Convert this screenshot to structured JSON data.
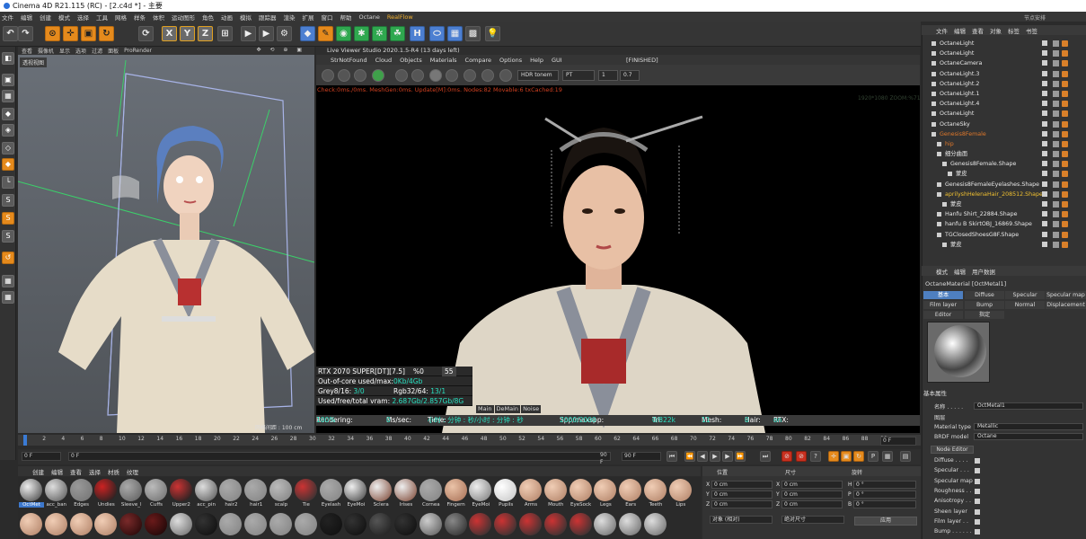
{
  "app": {
    "title": "Cinema 4D R21.115 (RC) - [2.c4d *] - 主要",
    "right_label": "节点安排"
  },
  "menubar": [
    "文件",
    "编辑",
    "创建",
    "模式",
    "选择",
    "工具",
    "网格",
    "样条",
    "体积",
    "运动图形",
    "角色",
    "动画",
    "模拟",
    "跟踪器",
    "渲染",
    "扩展",
    "窗口",
    "帮助",
    "Octane"
  ],
  "menubar_rf": "RealFlow",
  "toolbar": {
    "buttons": [
      {
        "name": "undo-button",
        "glyph": "↶",
        "style": ""
      },
      {
        "name": "redo-button",
        "glyph": "↷",
        "style": ""
      },
      {
        "name": "live-select-button",
        "glyph": "⊙",
        "style": "orange"
      },
      {
        "name": "move-button",
        "glyph": "✛",
        "style": "orange"
      },
      {
        "name": "scale-button",
        "glyph": "▣",
        "style": "orange"
      },
      {
        "name": "rotate-button",
        "glyph": "↻",
        "style": "orange"
      },
      {
        "name": "recent-tool-button",
        "glyph": "⟳",
        "style": ""
      },
      {
        "name": "axis-x-button",
        "glyph": "X",
        "style": "sel"
      },
      {
        "name": "axis-y-button",
        "glyph": "Y",
        "style": "sel"
      },
      {
        "name": "axis-z-button",
        "glyph": "Z",
        "style": "sel"
      },
      {
        "name": "coord-system-button",
        "glyph": "⊞",
        "style": ""
      },
      {
        "name": "render-view-button",
        "glyph": "▶",
        "style": ""
      },
      {
        "name": "render-pv-button",
        "glyph": "▶",
        "style": ""
      },
      {
        "name": "render-settings-button",
        "glyph": "⚙",
        "style": ""
      },
      {
        "name": "cube-button",
        "glyph": "◆",
        "style": "blue"
      },
      {
        "name": "pen-button",
        "glyph": "✎",
        "style": "orange"
      },
      {
        "name": "subdivision-button",
        "glyph": "◉",
        "style": "green"
      },
      {
        "name": "cloner-button",
        "glyph": "✱",
        "style": "green"
      },
      {
        "name": "deformer-button",
        "glyph": "✲",
        "style": "green"
      },
      {
        "name": "environment-button",
        "glyph": "☘",
        "style": "green"
      },
      {
        "name": "field-button",
        "glyph": "H",
        "style": "blue"
      },
      {
        "name": "tag-button",
        "glyph": "⬭",
        "style": "blue"
      },
      {
        "name": "floor-button",
        "glyph": "▦",
        "style": "blue"
      },
      {
        "name": "camera-button",
        "glyph": "▩",
        "style": ""
      },
      {
        "name": "light-button",
        "glyph": "💡",
        "style": ""
      }
    ]
  },
  "left_tools": [
    {
      "name": "make-editable-icon",
      "glyph": "◧",
      "style": ""
    },
    {
      "name": "model-mode-icon",
      "glyph": "▣",
      "style": ""
    },
    {
      "name": "texture-mode-icon",
      "glyph": "▦",
      "style": ""
    },
    {
      "name": "object-mode-icon",
      "glyph": "◆",
      "style": ""
    },
    {
      "name": "points-mode-icon",
      "glyph": "◈",
      "style": ""
    },
    {
      "name": "edges-mode-icon",
      "glyph": "◇",
      "style": ""
    },
    {
      "name": "polygons-mode-icon",
      "glyph": "◆",
      "style": "orange"
    },
    {
      "name": "axis-mode-icon",
      "glyph": "└",
      "style": ""
    },
    {
      "name": "snap-icon",
      "glyph": "S",
      "style": ""
    },
    {
      "name": "snap-settings-icon",
      "glyph": "S",
      "style": "orange"
    },
    {
      "name": "snap-quantize-icon",
      "glyph": "S",
      "style": ""
    },
    {
      "name": "workplane-icon",
      "glyph": "↺",
      "style": "orange"
    },
    {
      "name": "grid-icon",
      "glyph": "▦",
      "style": ""
    },
    {
      "name": "locked-workplane-icon",
      "glyph": "▦",
      "style": ""
    }
  ],
  "viewport": {
    "menu": [
      "查看",
      "摄像机",
      "显示",
      "选项",
      "过滤",
      "面板",
      "ProRender"
    ],
    "label": "透视视图",
    "grid": "网格间距 : 100 cm"
  },
  "liveviewer": {
    "title": "Live Viewer Studio 2020.1.5-R4 (13 days left)",
    "menu": [
      "StrNotFound",
      "Cloud",
      "Objects",
      "Materials",
      "Compare",
      "Options",
      "Help",
      "GUI"
    ],
    "status": "[FINISHED]",
    "tonemap": "HDR tonem",
    "kernel": "PT",
    "num1": "1",
    "num2": "0.7",
    "check": "Check:0ms./0ms. MeshGen:0ms. Update[M]:0ms. Nodes:82 Movable:6 txCached:19",
    "res": "1920*1080 ZOOM:%71",
    "stats": {
      "gpu": "RTX 2070 SUPER[DT][7.5]",
      "pct_label": "%0",
      "pct": "55",
      "ooc_label": "Out-of-core used/max:",
      "ooc": "0Kb/4Gb",
      "grey_label": "Grey8/16:",
      "grey": "3/0",
      "rgb_label": "Rgb32/64:",
      "rgb": "13/1",
      "vram_label": "Used/free/total vram:",
      "vram": "2.687Gb/2.857Gb/8G"
    },
    "tabs": [
      "Main",
      "DeMain",
      "Noise"
    ],
    "render": {
      "rendering_label": "Rendering:",
      "rendering": "100%",
      "ms_label": "Ms/sec:",
      "ms": "0",
      "time_label": "Time:",
      "time": "小时 : 分钟 : 秒/小时 : 分钟 : 秒",
      "spp_label": "Spp/maxspp:",
      "spp": "2000/2000",
      "tri_label": "Tri:",
      "tri": "0/822k",
      "mesh_label": "Mesh:",
      "mesh": "11",
      "hair_label": "Hair:",
      "hair": "0",
      "rtx_label": "RTX:",
      "rtx": "on"
    }
  },
  "timeline": {
    "ticks": [
      "0",
      "2",
      "4",
      "6",
      "8",
      "10",
      "12",
      "14",
      "16",
      "18",
      "20",
      "22",
      "24",
      "26",
      "28",
      "30",
      "32",
      "34",
      "36",
      "38",
      "40",
      "42",
      "44",
      "46",
      "48",
      "50",
      "52",
      "54",
      "56",
      "58",
      "60",
      "62",
      "64",
      "66",
      "68",
      "70",
      "72",
      "74",
      "76",
      "78",
      "80",
      "82",
      "84",
      "86",
      "88",
      "90"
    ],
    "frame_field": "0 F",
    "start": "0 F",
    "current": "0 F",
    "end": "90 F",
    "end2": "90 F"
  },
  "materials": {
    "menu": [
      "创建",
      "编辑",
      "查看",
      "选择",
      "材质",
      "纹理"
    ],
    "row1": [
      {
        "label": "OctMet",
        "c1": "#eee",
        "c2": "#555"
      },
      {
        "label": "acc_ban",
        "c1": "#ddd",
        "c2": "#666"
      },
      {
        "label": "Edges",
        "c1": "#999",
        "c2": "#777"
      },
      {
        "label": "Undies",
        "c1": "#c22",
        "c2": "#222"
      },
      {
        "label": "Sleeve_l",
        "c1": "#aaa",
        "c2": "#666"
      },
      {
        "label": "Cuffs",
        "c1": "#bbb",
        "c2": "#777"
      },
      {
        "label": "Upper2",
        "c1": "#c33",
        "c2": "#222"
      },
      {
        "label": "acc_pin",
        "c1": "#ddd",
        "c2": "#666"
      },
      {
        "label": "hair2",
        "c1": "#aaa",
        "c2": "#888"
      },
      {
        "label": "hair1",
        "c1": "#aaa",
        "c2": "#888"
      },
      {
        "label": "scalp",
        "c1": "#bbb",
        "c2": "#888"
      },
      {
        "label": "Tie",
        "c1": "#c33",
        "c2": "#333"
      },
      {
        "label": "Eyelash",
        "c1": "#aaa",
        "c2": "#888"
      },
      {
        "label": "EyeMoi",
        "c1": "#eee",
        "c2": "#555"
      },
      {
        "label": "Sclera",
        "c1": "#eee",
        "c2": "#8a5a4a"
      },
      {
        "label": "Irises",
        "c1": "#eee",
        "c2": "#8a5a4a"
      },
      {
        "label": "Cornea",
        "c1": "#aaa",
        "c2": "#888"
      },
      {
        "label": "Fingern",
        "c1": "#eac3a8",
        "c2": "#b07a60"
      },
      {
        "label": "EyeMoi",
        "c1": "#eee",
        "c2": "#888"
      },
      {
        "label": "Pupils",
        "c1": "#fff",
        "c2": "#ccc"
      },
      {
        "label": "Arms",
        "c1": "#f0cdb5",
        "c2": "#b88a70"
      },
      {
        "label": "Mouth",
        "c1": "#f0cdb5",
        "c2": "#b88a70"
      },
      {
        "label": "EyeSock",
        "c1": "#f0cdb5",
        "c2": "#b88a70"
      },
      {
        "label": "Legs",
        "c1": "#f0cdb5",
        "c2": "#b88a70"
      },
      {
        "label": "Ears",
        "c1": "#f0cdb5",
        "c2": "#b88a70"
      },
      {
        "label": "Teeth",
        "c1": "#f0cdb5",
        "c2": "#b88a70"
      },
      {
        "label": "Lips",
        "c1": "#f0cdb5",
        "c2": "#b88a70"
      }
    ],
    "row2": [
      {
        "c1": "#f0cdb5",
        "c2": "#b88a70"
      },
      {
        "c1": "#f0cdb5",
        "c2": "#b88a70"
      },
      {
        "c1": "#f0cdb5",
        "c2": "#b88a70"
      },
      {
        "c1": "#f0cdb5",
        "c2": "#b88a70"
      },
      {
        "c1": "#7a2a2a",
        "c2": "#2a0a0a"
      },
      {
        "c1": "#6a1a1a",
        "c2": "#200808"
      },
      {
        "c1": "#ddd",
        "c2": "#777"
      },
      {
        "c1": "#333",
        "c2": "#111"
      },
      {
        "c1": "#aaa",
        "c2": "#888"
      },
      {
        "c1": "#aaa",
        "c2": "#888"
      },
      {
        "c1": "#aaa",
        "c2": "#888"
      },
      {
        "c1": "#aaa",
        "c2": "#888"
      },
      {
        "c1": "#222",
        "c2": "#111"
      },
      {
        "c1": "#333",
        "c2": "#111"
      },
      {
        "c1": "#555",
        "c2": "#222"
      },
      {
        "c1": "#333",
        "c2": "#111"
      },
      {
        "c1": "#ccc",
        "c2": "#666"
      },
      {
        "c1": "#888",
        "c2": "#333"
      },
      {
        "c1": "#c33",
        "c2": "#333"
      },
      {
        "c1": "#c33",
        "c2": "#333"
      },
      {
        "c1": "#c33",
        "c2": "#333"
      },
      {
        "c1": "#c33",
        "c2": "#333"
      },
      {
        "c1": "#c33",
        "c2": "#333"
      },
      {
        "c1": "#ddd",
        "c2": "#777"
      },
      {
        "c1": "#ddd",
        "c2": "#777"
      },
      {
        "c1": "#ddd",
        "c2": "#777"
      }
    ]
  },
  "coords": {
    "headers": [
      "位置",
      "尺寸",
      "旋转"
    ],
    "rows": [
      {
        "axis": "X",
        "pos": "0 cm",
        "saxis": "X",
        "size": "0 cm",
        "raxis": "H",
        "rot": "0 °"
      },
      {
        "axis": "Y",
        "pos": "0 cm",
        "saxis": "Y",
        "size": "0 cm",
        "raxis": "P",
        "rot": "0 °"
      },
      {
        "axis": "Z",
        "pos": "0 cm",
        "saxis": "Z",
        "size": "0 cm",
        "raxis": "B",
        "rot": "0 °"
      }
    ],
    "mode": "对象 (相对)",
    "size_mode": "绝对尺寸",
    "apply": "应用"
  },
  "objects": {
    "menu": [
      "文件",
      "编辑",
      "查看",
      "对象",
      "标签",
      "书签"
    ],
    "items": [
      {
        "name": "OctaneLight",
        "indent": 0,
        "color": "#e8e8e8"
      },
      {
        "name": "OctaneLight",
        "indent": 0,
        "color": "#e8e8e8"
      },
      {
        "name": "OctaneCamera",
        "indent": 0,
        "color": "#e8e8e8"
      },
      {
        "name": "OctaneLight.3",
        "indent": 0,
        "color": "#e8e8e8"
      },
      {
        "name": "OctaneLight.2",
        "indent": 0,
        "color": "#e8e8e8"
      },
      {
        "name": "OctaneLight.1",
        "indent": 0,
        "color": "#e8e8e8"
      },
      {
        "name": "OctaneLight.4",
        "indent": 0,
        "color": "#e8e8e8"
      },
      {
        "name": "OctaneLight",
        "indent": 0,
        "color": "#e8e8e8"
      },
      {
        "name": "OctaneSky",
        "indent": 0,
        "color": "#e8e8e8"
      },
      {
        "name": "Genesis8Female",
        "indent": 0,
        "color": "#e0782a"
      },
      {
        "name": "hip",
        "indent": 1,
        "color": "#e0782a"
      },
      {
        "name": "细分曲面",
        "indent": 1,
        "color": "#e8e8e8"
      },
      {
        "name": "Genesis8Female.Shape",
        "indent": 2,
        "color": "#e8e8e8"
      },
      {
        "name": "蒙皮",
        "indent": 3,
        "color": "#e8e8e8"
      },
      {
        "name": "Genesis8FemaleEyelashes.Shape",
        "indent": 1,
        "color": "#e8e8e8"
      },
      {
        "name": "aprilyshHelenaHair_208512.Shape",
        "indent": 1,
        "color": "#f0c030"
      },
      {
        "name": "蒙皮",
        "indent": 2,
        "color": "#e8e8e8"
      },
      {
        "name": "Hanfu Shirt_22884.Shape",
        "indent": 1,
        "color": "#e8e8e8"
      },
      {
        "name": "hanfu B SkirtOBJ_16869.Shape",
        "indent": 1,
        "color": "#e8e8e8"
      },
      {
        "name": "TGClosedShoesG8F.Shape",
        "indent": 1,
        "color": "#e8e8e8"
      },
      {
        "name": "蒙皮",
        "indent": 2,
        "color": "#e8e8e8"
      }
    ]
  },
  "attributes": {
    "menu": [
      "模式",
      "编辑",
      "用户数据"
    ],
    "name": "OctaneMaterial [OctMetal1]",
    "tabs": [
      {
        "label": "基本",
        "on": true
      },
      {
        "label": "Diffuse",
        "on": false
      },
      {
        "label": "Specular",
        "on": false
      },
      {
        "label": "Specular map",
        "on": false
      },
      {
        "label": "Film layer",
        "on": false
      },
      {
        "label": "Bump",
        "on": false
      },
      {
        "label": "Normal",
        "on": false
      },
      {
        "label": "Displacement",
        "on": false
      },
      {
        "label": "Editor",
        "on": false
      },
      {
        "label": "指定",
        "on": false
      }
    ],
    "basic_title": "基本属性",
    "name_label": "名称 . . . . .",
    "name_value": "OctMetal1",
    "layer_label": "图层",
    "type_label": "Material type",
    "type_value": "Metallic",
    "brdf_label": "BRDF model",
    "brdf_value": "Octane",
    "node_editor": "Node Editor",
    "channels": [
      "Diffuse . . . .",
      "Specular . . .",
      "Specular map",
      "Roughness . .",
      "Anisotropy . .",
      "Sheen layer",
      "Film layer . .",
      "Bump . . . . . ."
    ]
  }
}
